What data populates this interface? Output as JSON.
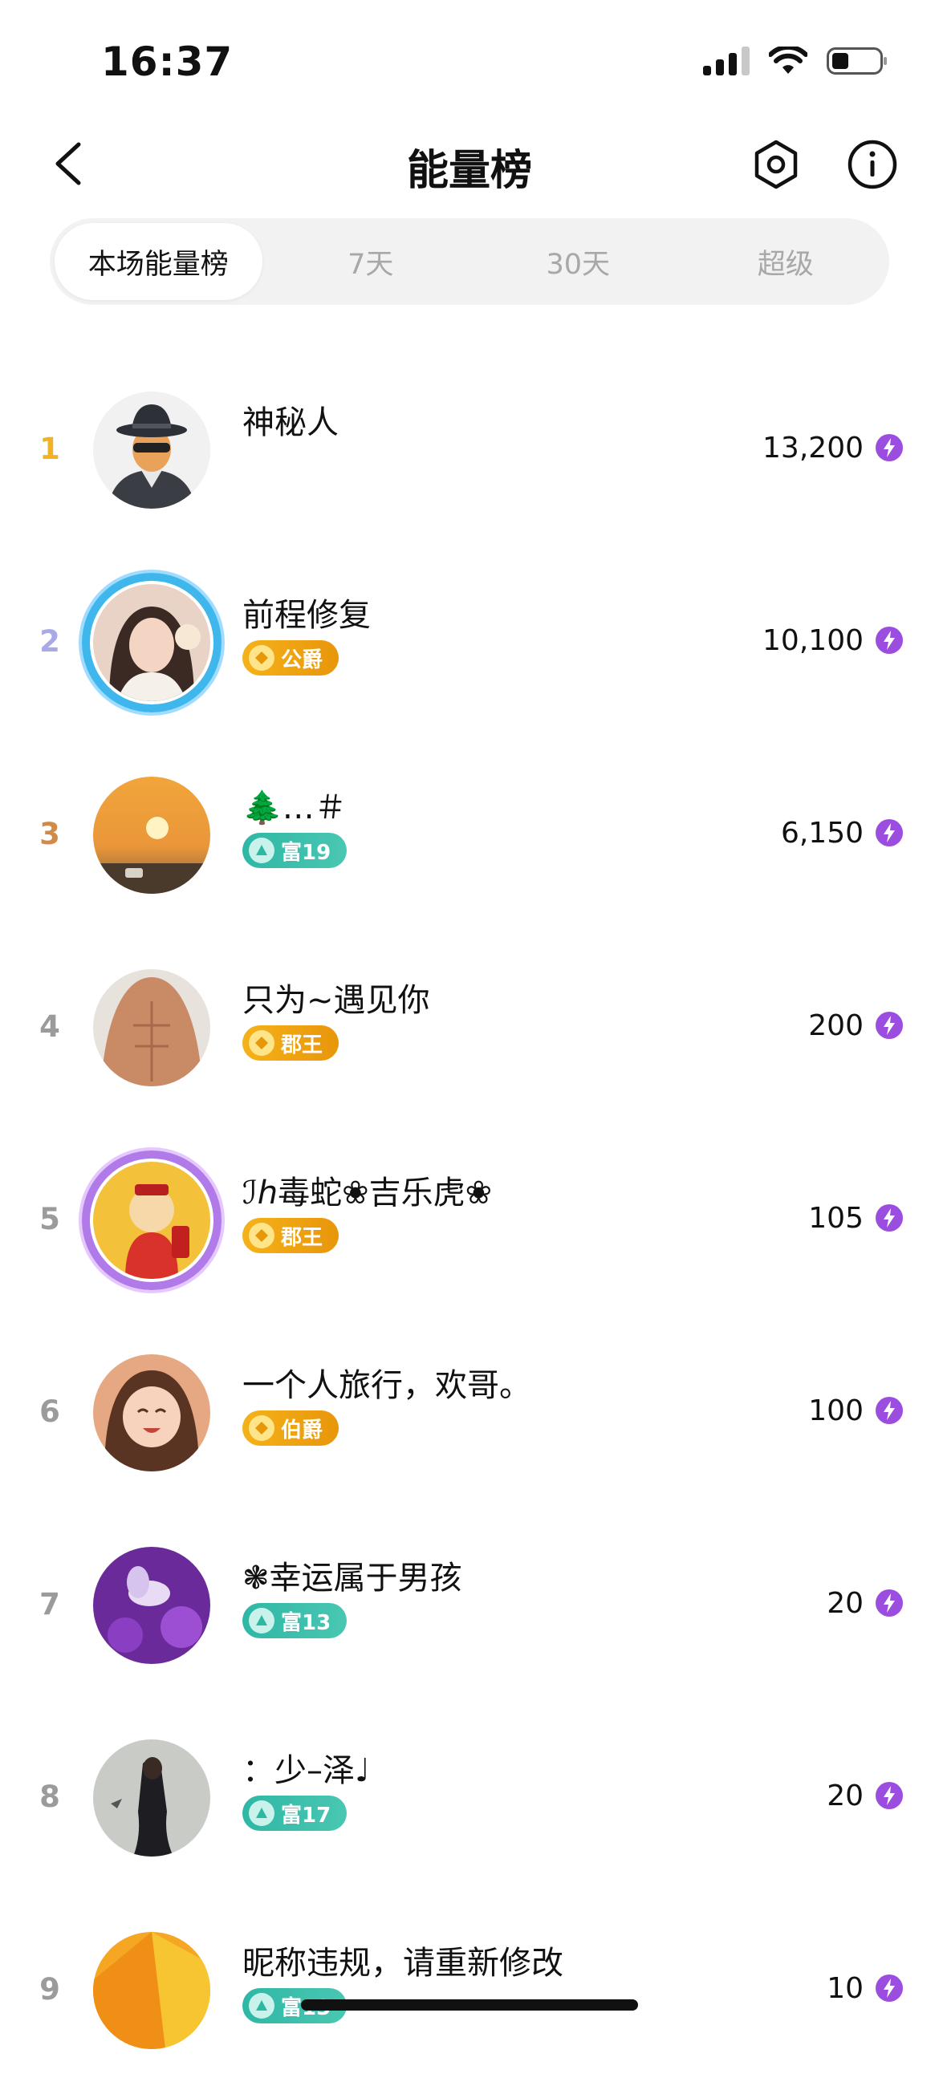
{
  "status_bar": {
    "time": "16:37"
  },
  "nav": {
    "title": "能量榜"
  },
  "tabs": [
    {
      "label": "本场能量榜",
      "active": true
    },
    {
      "label": "7天",
      "active": false
    },
    {
      "label": "30天",
      "active": false
    },
    {
      "label": "超级",
      "active": false
    }
  ],
  "ranking": [
    {
      "rank": "1",
      "rank_color": "#f0b323",
      "name": "神秘人",
      "badge": "",
      "badge_type": "",
      "score": "13,200"
    },
    {
      "rank": "2",
      "rank_color": "#a9a9e8",
      "name": "前程修复",
      "badge": "公爵",
      "badge_type": "gold",
      "score": "10,100"
    },
    {
      "rank": "3",
      "rank_color": "#d08a4a",
      "name": "🌲…＃",
      "badge": "富19",
      "badge_type": "teal",
      "score": "6,150"
    },
    {
      "rank": "4",
      "rank_color": "#9b9b9b",
      "name": "只为~遇见你",
      "badge": "郡王",
      "badge_type": "gold",
      "score": "200"
    },
    {
      "rank": "5",
      "rank_color": "#9b9b9b",
      "name": "ℐℎ毒蛇❀吉乐虎❀",
      "badge": "郡王",
      "badge_type": "gold",
      "score": "105"
    },
    {
      "rank": "6",
      "rank_color": "#9b9b9b",
      "name": "一个人旅行，欢哥。",
      "badge": "伯爵",
      "badge_type": "gold",
      "score": "100"
    },
    {
      "rank": "7",
      "rank_color": "#9b9b9b",
      "name": "❃幸运属于男孩",
      "badge": "富13",
      "badge_type": "teal",
      "score": "20"
    },
    {
      "rank": "8",
      "rank_color": "#9b9b9b",
      "name": "：少–泽♩",
      "badge": "富17",
      "badge_type": "teal",
      "score": "20"
    },
    {
      "rank": "9",
      "rank_color": "#9b9b9b",
      "name": "昵称违规，请重新修改",
      "badge": "富13",
      "badge_type": "teal",
      "score": "10"
    }
  ],
  "icons": {
    "back": "chevron-left-icon",
    "settings": "hexagon-settings-icon",
    "info": "info-icon",
    "energy": "lightning-energy-icon"
  },
  "colors": {
    "gold_badge": "#f5b21a",
    "teal_badge": "#2fb7a6",
    "energy": "#9b4de0"
  }
}
